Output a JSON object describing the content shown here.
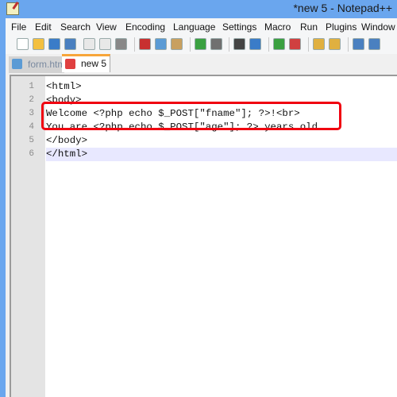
{
  "window": {
    "title": "*new  5 - Notepad++"
  },
  "menu": [
    "File",
    "Edit",
    "Search",
    "View",
    "Encoding",
    "Language",
    "Settings",
    "Macro",
    "Run",
    "Plugins",
    "Window"
  ],
  "toolbar": {
    "icons": [
      "new-file-icon",
      "open-file-icon",
      "save-icon",
      "save-all-icon",
      "close-icon",
      "close-all-icon",
      "print-icon",
      "cut-icon",
      "copy-icon",
      "paste-icon",
      "undo-icon",
      "redo-icon",
      "find-icon",
      "replace-icon",
      "zoom-in-icon",
      "zoom-out-icon",
      "sync-vertical-icon",
      "sync-horizontal-icon",
      "word-wrap-icon",
      "show-all-chars-icon"
    ]
  },
  "tabs": [
    {
      "label": "form.html",
      "active": false,
      "color": "#5b9bd5"
    },
    {
      "label": "new  5",
      "active": true,
      "color": "#e04040"
    }
  ],
  "editor": {
    "lines": [
      {
        "n": "1",
        "text": "<html>"
      },
      {
        "n": "2",
        "text": "<body>"
      },
      {
        "n": "3",
        "text": "Welcome <?php echo $_POST[\"fname\"]; ?>!<br>"
      },
      {
        "n": "4",
        "text": "You are <?php echo $_POST[\"age\"]; ?> years old."
      },
      {
        "n": "5",
        "text": "</body>"
      },
      {
        "n": "6",
        "text": "</html>"
      }
    ],
    "current_line": "6",
    "highlight_color": "#f00010"
  }
}
